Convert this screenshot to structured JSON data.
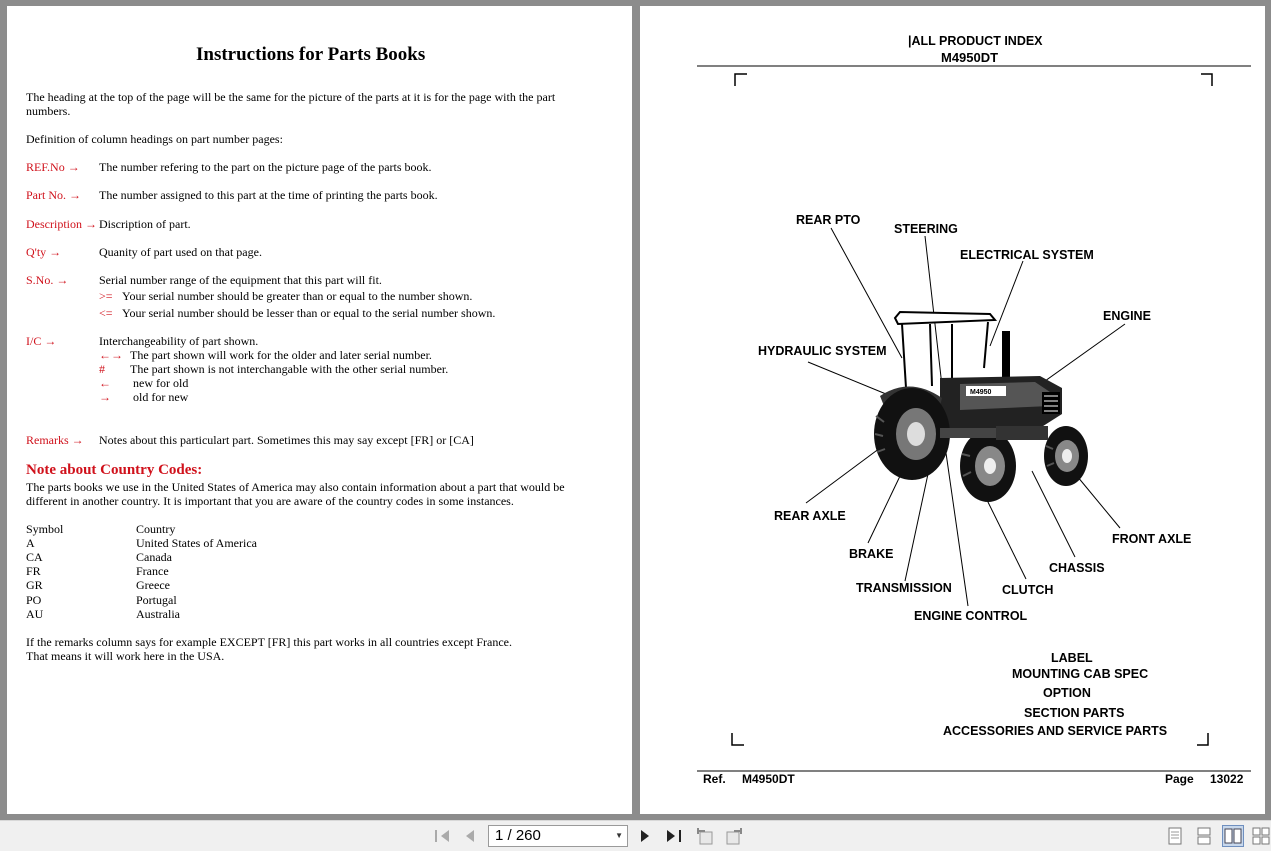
{
  "left": {
    "title": "Instructions for Parts Books",
    "intro_line1": "The heading at the top of the page will be the same for the picture of the parts at it is for the page with the part",
    "intro_line2": "numbers.",
    "definition": "Definition of column headings on part number pages:",
    "defs": [
      {
        "term": "REF.No →",
        "desc": "The number refering to the part on the picture page of the parts book."
      },
      {
        "term": "Part No. →",
        "desc": "The number assigned to this part at the time of printing the parts book."
      },
      {
        "term": "Description →",
        "desc": "Discription of part."
      },
      {
        "term": "Q'ty →",
        "desc": "Quanity of part used on that page."
      },
      {
        "term": "S.No. →",
        "desc": "Serial number range of the equipment that this part will fit."
      },
      {
        "term": "I/C →",
        "desc": "Interchangeability of part shown."
      },
      {
        "term": "Remarks →",
        "desc": "Notes about this particulart part. Sometimes this may say except [FR] or [CA]"
      }
    ],
    "sno_sub": [
      {
        "sym": ">=",
        "text": "Your serial number should be greater than or equal to the number shown."
      },
      {
        "sym": "<=",
        "text": "Your serial number should be lesser than or equal to the serial number shown."
      }
    ],
    "ic_sub": [
      {
        "sym": "←→",
        "text": "The part shown will work for the older and later serial number."
      },
      {
        "sym": "#",
        "text": "The part shown is not interchangable with the other serial number."
      },
      {
        "sym": "←",
        "text": "new for old"
      },
      {
        "sym": "→",
        "text": "old for new"
      }
    ],
    "note_title": "Note about Country Codes:",
    "note_line1": "The parts books we use in the United States of America may also contain information about a part that would be",
    "note_line2": "different in another country. It is important that you are aware of the country codes in some instances.",
    "codes_header": {
      "symbol": "Symbol",
      "country": "Country"
    },
    "codes": [
      {
        "symbol": "A",
        "country": "United States of America"
      },
      {
        "symbol": "CA",
        "country": "Canada"
      },
      {
        "symbol": "FR",
        "country": "France"
      },
      {
        "symbol": "GR",
        "country": "Greece"
      },
      {
        "symbol": "PO",
        "country": "Portugal"
      },
      {
        "symbol": "AU",
        "country": "Australia"
      }
    ],
    "footer_line1": "If the remarks column says for example EXCEPT [FR] this part works in all countries except France.",
    "footer_line2": "That means it will work here in the USA."
  },
  "right": {
    "header1": "|ALL PRODUCT INDEX",
    "header2": "M4950DT",
    "labels": {
      "rear_pto": "REAR PTO",
      "steering": "STEERING",
      "electrical": "ELECTRICAL SYSTEM",
      "engine": "ENGINE",
      "hydraulic": "HYDRAULIC SYSTEM",
      "rear_axle": "REAR AXLE",
      "front_axle": "FRONT AXLE",
      "brake": "BRAKE",
      "chassis": "CHASSIS",
      "transmission": "TRANSMISSION",
      "clutch": "CLUTCH",
      "engine_control": "ENGINE CONTROL"
    },
    "tractor_badge": "M4950",
    "sections": [
      "LABEL",
      "MOUNTING CAB SPEC",
      "OPTION",
      "SECTION PARTS",
      "ACCESSORIES AND SERVICE PARTS"
    ],
    "footer": {
      "ref_label": "Ref.",
      "ref_value": "M4950DT",
      "page_label": "Page",
      "page_value": "13022"
    }
  },
  "toolbar": {
    "page_value": "1 / 260"
  }
}
